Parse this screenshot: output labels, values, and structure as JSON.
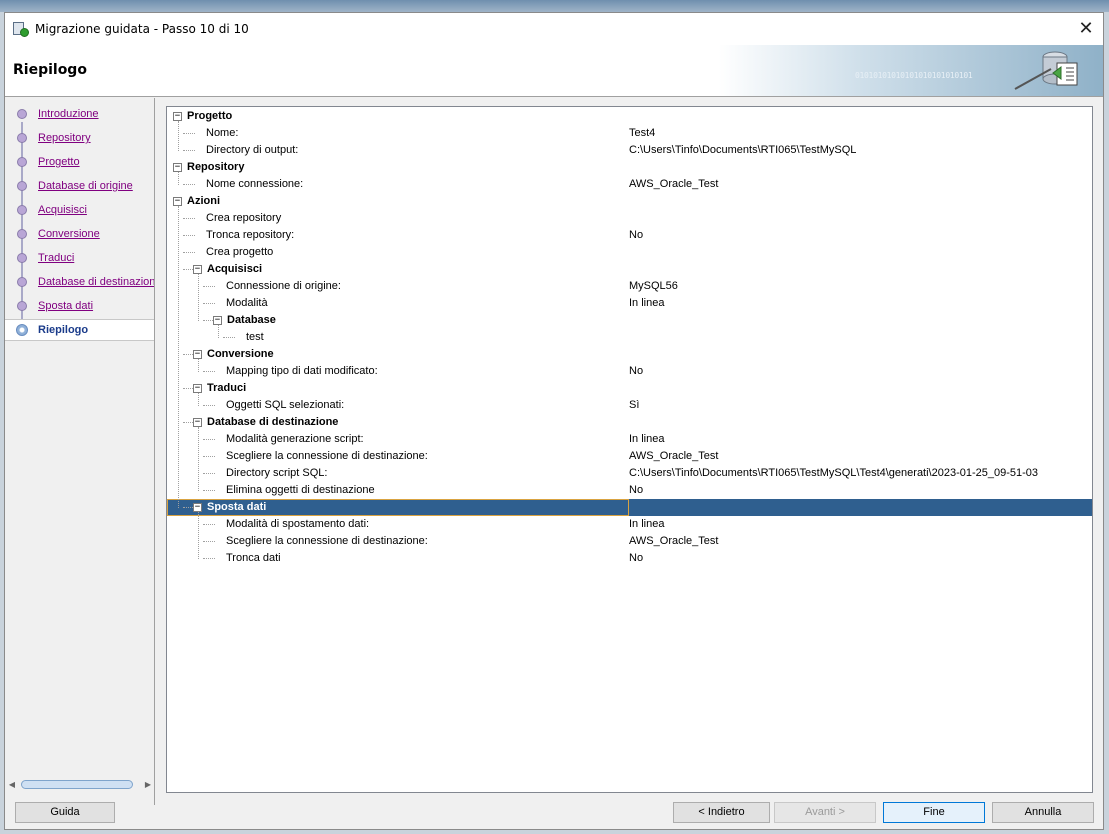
{
  "window": {
    "title": "Migrazione guidata - Passo 10 di 10",
    "close_label": "✕",
    "header_title": "Riepilogo",
    "header_pattern_text": "01010101010101010101010101"
  },
  "nav": {
    "items": [
      {
        "label": "Introduzione"
      },
      {
        "label": "Repository"
      },
      {
        "label": "Progetto"
      },
      {
        "label": "Database di origine"
      },
      {
        "label": "Acquisisci"
      },
      {
        "label": "Conversione"
      },
      {
        "label": "Traduci"
      },
      {
        "label": "Database di destinazione"
      },
      {
        "label": "Sposta dati"
      },
      {
        "label": "Riepilogo"
      }
    ],
    "active": "Riepilogo",
    "scroll_left": "◀",
    "scroll_right": "▶"
  },
  "tree": {
    "expanded_symbol": "−",
    "rows": [
      {
        "label": "Progetto",
        "value": "",
        "level": 0,
        "group": true
      },
      {
        "label": "Nome:",
        "value": "Test4",
        "level": 1,
        "group": false
      },
      {
        "label": "Directory di output:",
        "value": "C:\\Users\\Tinfo\\Documents\\RTI065\\TestMySQL",
        "level": 1,
        "group": false
      },
      {
        "label": "Repository",
        "value": "",
        "level": 0,
        "group": true
      },
      {
        "label": "Nome connessione:",
        "value": "AWS_Oracle_Test",
        "level": 1,
        "group": false
      },
      {
        "label": "Azioni",
        "value": "",
        "level": 0,
        "group": true
      },
      {
        "label": "Crea repository",
        "value": "",
        "level": 1,
        "group": false
      },
      {
        "label": "Tronca repository:",
        "value": "No",
        "level": 1,
        "group": false
      },
      {
        "label": "Crea progetto",
        "value": "",
        "level": 1,
        "group": false
      },
      {
        "label": "Acquisisci",
        "value": "",
        "level": 1,
        "group": true
      },
      {
        "label": "Connessione di origine:",
        "value": "MySQL56",
        "level": 2,
        "group": false
      },
      {
        "label": "Modalità",
        "value": "In linea",
        "level": 2,
        "group": false
      },
      {
        "label": "Database",
        "value": "",
        "level": 2,
        "group": true
      },
      {
        "label": "test",
        "value": "",
        "level": 3,
        "group": false
      },
      {
        "label": "Conversione",
        "value": "",
        "level": 1,
        "group": true
      },
      {
        "label": "Mapping tipo di dati modificato:",
        "value": "No",
        "level": 2,
        "group": false
      },
      {
        "label": "Traduci",
        "value": "",
        "level": 1,
        "group": true
      },
      {
        "label": "Oggetti SQL selezionati:",
        "value": "Sì",
        "level": 2,
        "group": false
      },
      {
        "label": "Database di destinazione",
        "value": "",
        "level": 1,
        "group": true
      },
      {
        "label": "Modalità generazione script:",
        "value": "In linea",
        "level": 2,
        "group": false
      },
      {
        "label": "Scegliere la connessione di destinazione:",
        "value": "AWS_Oracle_Test",
        "level": 2,
        "group": false
      },
      {
        "label": "Directory script SQL:",
        "value": "C:\\Users\\Tinfo\\Documents\\RTI065\\TestMySQL\\Test4\\generati\\2023-01-25_09-51-03",
        "level": 2,
        "group": false
      },
      {
        "label": "Elimina oggetti di destinazione",
        "value": "No",
        "level": 2,
        "group": false
      },
      {
        "label": "Sposta dati",
        "value": "",
        "level": 1,
        "group": true,
        "selected": true
      },
      {
        "label": "Modalità di spostamento dati:",
        "value": "In linea",
        "level": 2,
        "group": false
      },
      {
        "label": "Scegliere la connessione di destinazione:",
        "value": "AWS_Oracle_Test",
        "level": 2,
        "group": false
      },
      {
        "label": "Tronca dati",
        "value": "No",
        "level": 2,
        "group": false
      }
    ]
  },
  "buttons": {
    "help": "Guida",
    "back": "< Indietro",
    "next": "Avanti >",
    "finish": "Fine",
    "cancel": "Annulla"
  },
  "colors": {
    "selection": "#2f5f8f",
    "visited_link": "#800080",
    "active_step": "#1a3b8a"
  }
}
